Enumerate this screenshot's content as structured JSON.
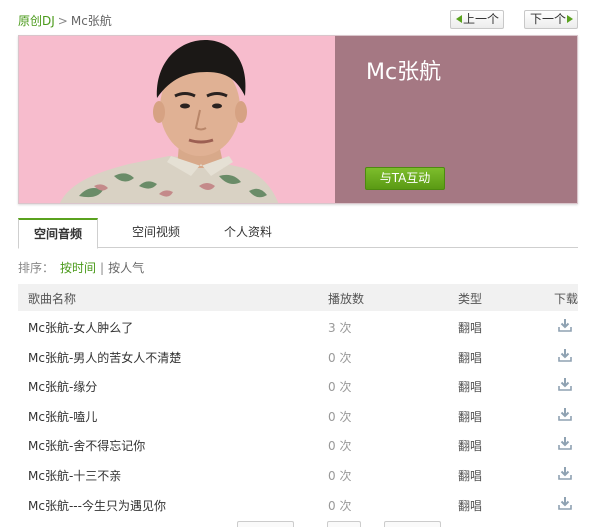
{
  "breadcrumb": {
    "parent": "原创DJ",
    "separator": ">",
    "current": "Mc张航"
  },
  "pager": {
    "prev_label": "上一个",
    "next_label": "下一个"
  },
  "banner": {
    "artist_name": "Mc张航",
    "interact_label": "与TA互动",
    "colors": {
      "photo_bg": "#f5b8cb",
      "info_bg": "#a57883",
      "accent": "#5a9a14"
    }
  },
  "tabs": [
    {
      "label": "空间音频",
      "active": true
    },
    {
      "label": "空间视频",
      "active": false
    },
    {
      "label": "个人资料",
      "active": false
    }
  ],
  "sort": {
    "label": "排序：",
    "by_time": "按时间",
    "divider": "|",
    "by_popularity": "按人气"
  },
  "table": {
    "headers": {
      "name": "歌曲名称",
      "plays": "播放数",
      "type": "类型",
      "download": "下载"
    },
    "rows": [
      {
        "name": "Mc张航-女人肿么了",
        "plays": "3 次",
        "type": "翻唱"
      },
      {
        "name": "Mc张航-男人的苦女人不清楚",
        "plays": "0 次",
        "type": "翻唱"
      },
      {
        "name": "Mc张航-缘分",
        "plays": "0 次",
        "type": "翻唱"
      },
      {
        "name": "Mc张航-嗑儿",
        "plays": "0 次",
        "type": "翻唱"
      },
      {
        "name": "Mc张航-舍不得忘记你",
        "plays": "0 次",
        "type": "翻唱"
      },
      {
        "name": "Mc张航-十三不亲",
        "plays": "0 次",
        "type": "翻唱"
      },
      {
        "name": "Mc张航---今生只为遇见你",
        "plays": "0 次",
        "type": "翻唱"
      }
    ],
    "download_icon": "download-icon"
  }
}
